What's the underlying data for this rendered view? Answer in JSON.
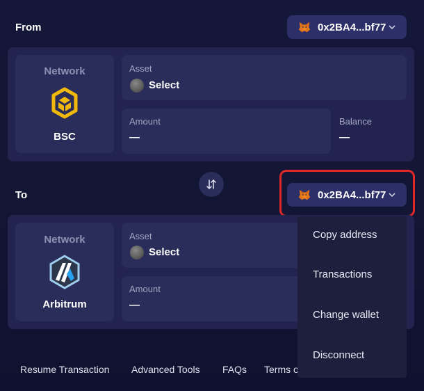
{
  "from": {
    "label": "From",
    "wallet": {
      "address": "0x2BA4...bf77",
      "icon": "metamask-fox-icon"
    },
    "network": {
      "label": "Network",
      "name": "BSC",
      "icon": "bsc-logo-icon",
      "color": "#f0b90b"
    },
    "asset": {
      "label": "Asset",
      "value": "Select"
    },
    "amount": {
      "label": "Amount",
      "value": "—"
    },
    "balance": {
      "label": "Balance",
      "value": "—"
    }
  },
  "swap": {
    "icon": "swap-vertical-icon"
  },
  "to": {
    "label": "To",
    "wallet": {
      "address": "0x2BA4...bf77",
      "icon": "metamask-fox-icon"
    },
    "network": {
      "label": "Network",
      "name": "Arbitrum",
      "icon": "arbitrum-logo-icon",
      "color": "#28a0f0"
    },
    "asset": {
      "label": "Asset",
      "value": "Select"
    },
    "amount": {
      "label": "Amount",
      "value": "—"
    }
  },
  "wallet_menu": {
    "items": [
      "Copy address",
      "Transactions",
      "Change wallet",
      "Disconnect"
    ]
  },
  "footer": {
    "links": [
      "Resume Transaction",
      "Advanced Tools",
      "FAQs",
      "Terms of"
    ]
  },
  "colors": {
    "highlight": "#e02828",
    "panel": "#22244f",
    "card": "#2a2c59",
    "button": "#2d2f68"
  }
}
